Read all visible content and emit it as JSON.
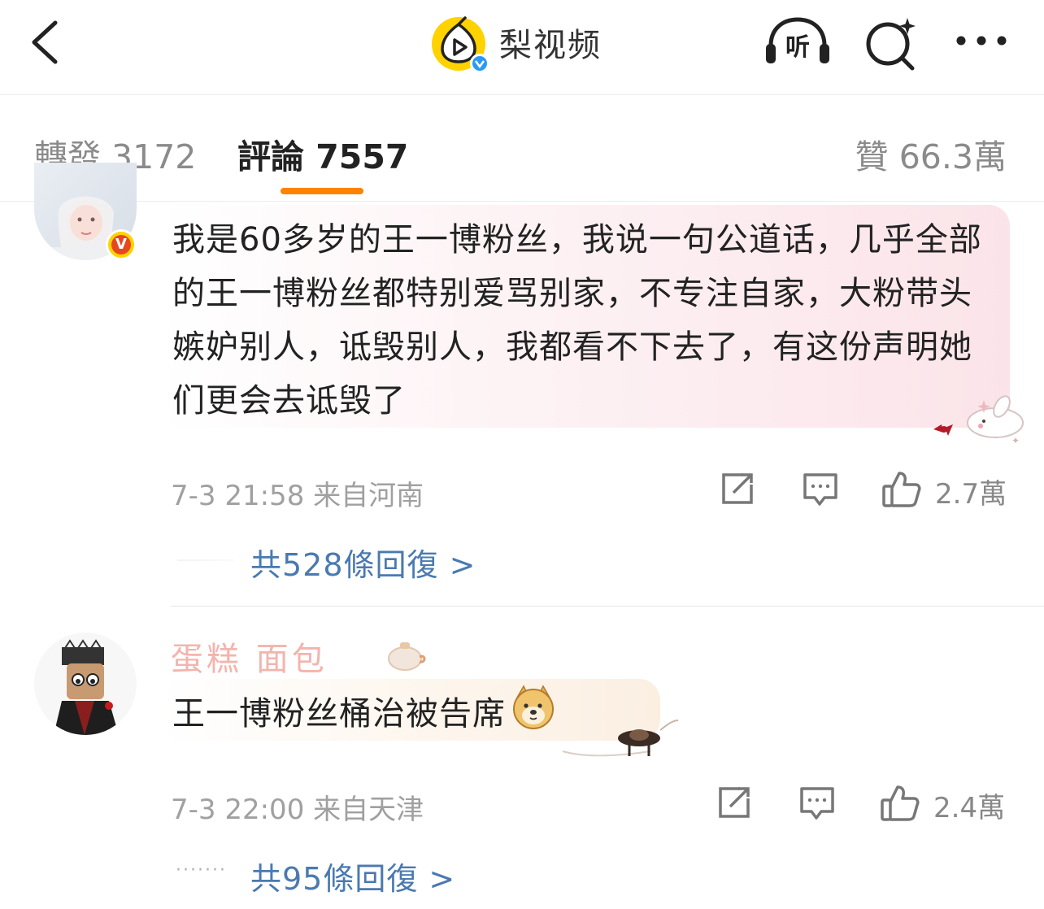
{
  "header": {
    "back_icon": "chevron-left-icon",
    "brand_name": "梨视频",
    "listen_label": "听",
    "search_icon": "search-sparkle-icon",
    "more_icon": "more-dots-icon",
    "accent": "#ffd200"
  },
  "tabs": {
    "repost": "轉發 3172",
    "comment": "評論 7557",
    "like": "贊 66.3萬",
    "active_color": "#ff8200"
  },
  "comments": [
    {
      "text": "我是60多岁的王一博粉丝，我说一句公道话，几乎全部的王一博粉丝都特别爱骂别家，不专注自家，大粉带头嫉妒别人，诋毁别人，我都看不下去了，有这份声明她们更会去诋毁了",
      "badge": "V",
      "time_location": "7-3 21:58  来自河南",
      "likes": "2.7萬",
      "replies": "共528條回復 >"
    },
    {
      "username": "蛋糕   面包",
      "text": "王一博粉丝桶治被告席",
      "time_location": "7-3 22:00  来自天津",
      "likes": "2.4萬",
      "replies": "共95條回復 >"
    }
  ]
}
